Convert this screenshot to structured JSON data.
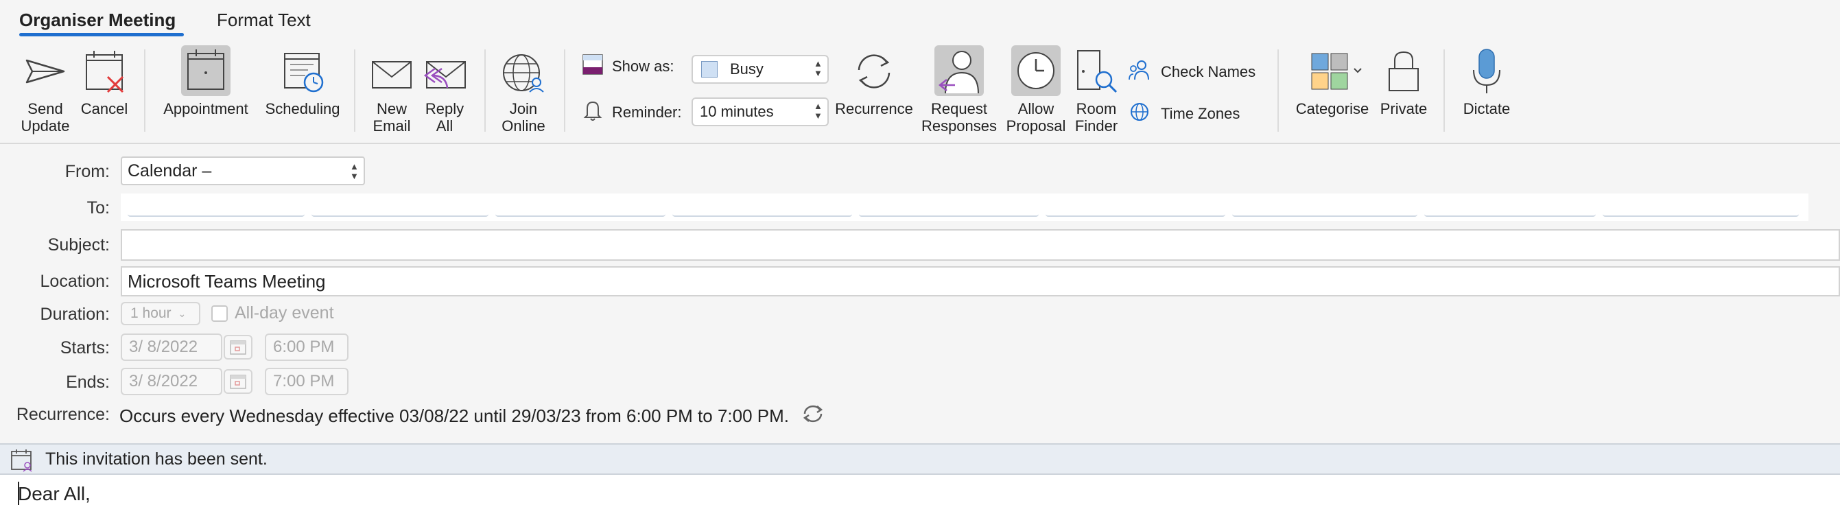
{
  "tabs": [
    {
      "label": "Organiser Meeting",
      "active": true
    },
    {
      "label": "Format Text",
      "active": false
    }
  ],
  "ribbon": {
    "send_update": "Send\nUpdate",
    "send_update_l1": "Send",
    "send_update_l2": "Update",
    "cancel": "Cancel",
    "appointment": "Appointment",
    "scheduling": "Scheduling",
    "new_email_l1": "New",
    "new_email_l2": "Email",
    "reply_all_l1": "Reply",
    "reply_all_l2": "All",
    "join_online_l1": "Join",
    "join_online_l2": "Online",
    "show_as_label": "Show as:",
    "show_as_value": "Busy",
    "reminder_label": "Reminder:",
    "reminder_value": "10 minutes",
    "recurrence": "Recurrence",
    "request_responses_l1": "Request",
    "request_responses_l2": "Responses",
    "allow_proposal_l1": "Allow",
    "allow_proposal_l2": "Proposal",
    "room_finder_l1": "Room",
    "room_finder_l2": "Finder",
    "check_names": "Check Names",
    "time_zones": "Time Zones",
    "categorise": "Categorise",
    "private": "Private",
    "dictate": "Dictate"
  },
  "form": {
    "from_label": "From:",
    "from_value": "Calendar –",
    "to_label": "To:",
    "subject_label": "Subject:",
    "subject_value": "",
    "location_label": "Location:",
    "location_value": "Microsoft Teams Meeting",
    "duration_label": "Duration:",
    "duration_value": "1 hour",
    "all_day_label": "All-day event",
    "starts_label": "Starts:",
    "starts_date": "3/  8/2022",
    "starts_time": "6:00 PM",
    "ends_label": "Ends:",
    "ends_date": "3/  8/2022",
    "ends_time": "7:00 PM",
    "recurrence_label": "Recurrence:",
    "recurrence_value": "Occurs every Wednesday effective 03/08/22 until 29/03/23 from 6:00 PM to 7:00 PM."
  },
  "infobar": {
    "text": "This invitation has been sent."
  },
  "body": {
    "text": "Dear All,"
  },
  "colors": {
    "accent": "#1f6fcf",
    "busy_swatch": "#cfe0f4",
    "purple": "#7a1f6f"
  }
}
